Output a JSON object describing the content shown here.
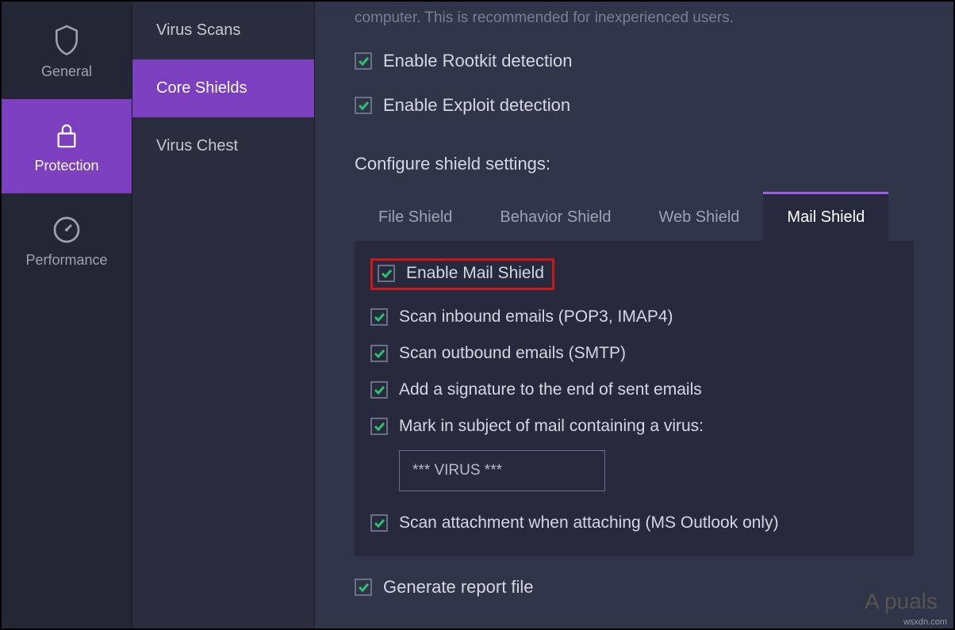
{
  "sidebar_primary": {
    "general": "General",
    "protection": "Protection",
    "performance": "Performance"
  },
  "sidebar_secondary": {
    "virus_scans": "Virus Scans",
    "core_shields": "Core Shields",
    "virus_chest": "Virus Chest"
  },
  "content": {
    "partial_header": "computer. This is recommended for inexperienced users.",
    "enable_rootkit": "Enable Rootkit detection",
    "enable_exploit": "Enable Exploit detection",
    "configure_label": "Configure shield settings:",
    "tabs": {
      "file_shield": "File Shield",
      "behavior_shield": "Behavior Shield",
      "web_shield": "Web Shield",
      "mail_shield": "Mail Shield"
    },
    "mail_shield": {
      "enable": "Enable Mail Shield",
      "scan_inbound": "Scan inbound emails (POP3, IMAP4)",
      "scan_outbound": "Scan outbound emails (SMTP)",
      "signature": "Add a signature to the end of sent emails",
      "mark_subject": "Mark in subject of mail containing a virus:",
      "virus_text": "*** VIRUS ***",
      "scan_attachment": "Scan attachment when attaching (MS Outlook only)"
    },
    "generate_report": "Generate report file"
  },
  "watermark": "A    puals",
  "watermark_site": "wsxdn.com"
}
